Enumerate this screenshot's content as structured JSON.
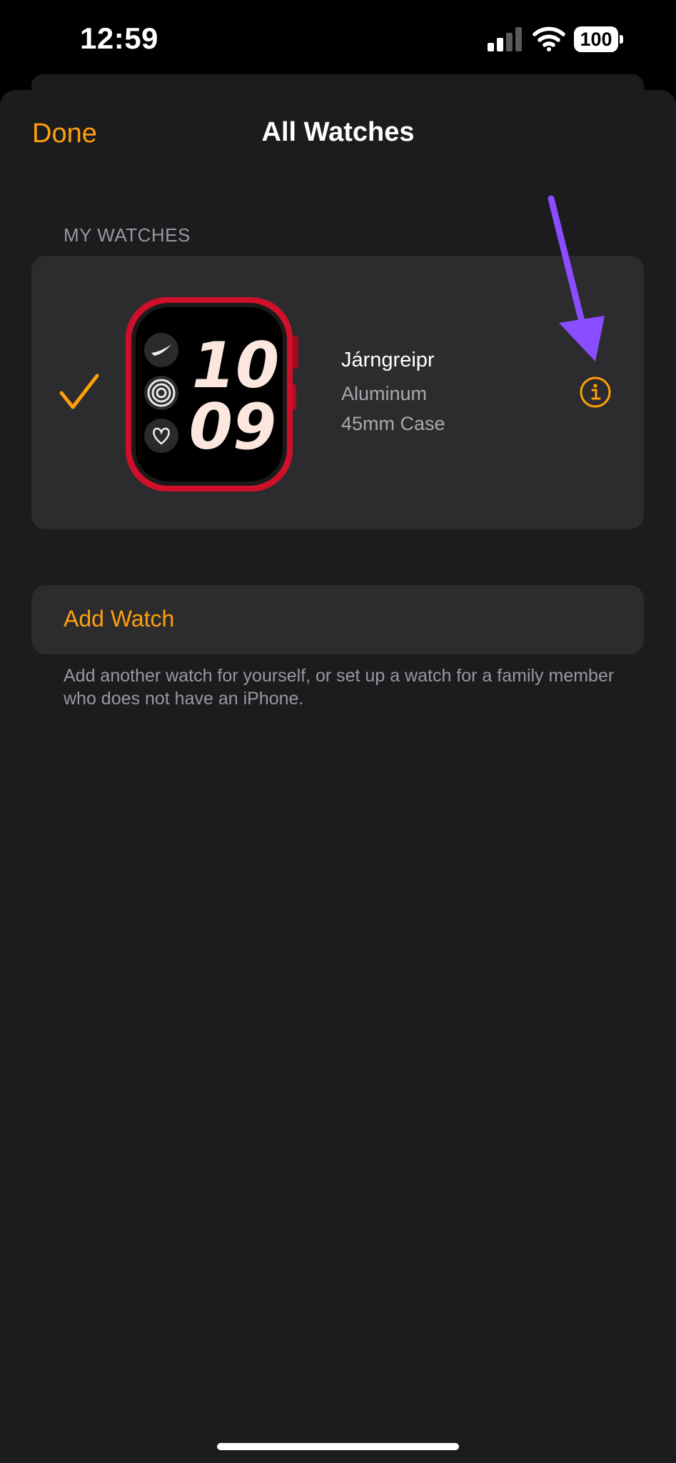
{
  "status_bar": {
    "time": "12:59",
    "battery_level": "100",
    "signal_icon": "cellular-signal-icon",
    "wifi_icon": "wifi-icon"
  },
  "nav": {
    "done_label": "Done",
    "title": "All Watches"
  },
  "my_watches": {
    "header": "MY WATCHES",
    "watch": {
      "name": "Járngreipr",
      "material": "Aluminum",
      "case": "45mm Case",
      "face_hour": "10",
      "face_minute": "09",
      "selected": true,
      "check_icon": "checkmark-icon",
      "info_icon": "info-icon"
    }
  },
  "add_watch": {
    "label": "Add Watch",
    "note": "Add another watch for yourself, or set up a watch for a family member who does not have an iPhone."
  },
  "colors": {
    "accent": "#ff9f0a",
    "background": "#1c1c1e",
    "cell": "#2c2c2e",
    "annotation_arrow": "#8a4dff",
    "watch_case": "#d0102a"
  }
}
